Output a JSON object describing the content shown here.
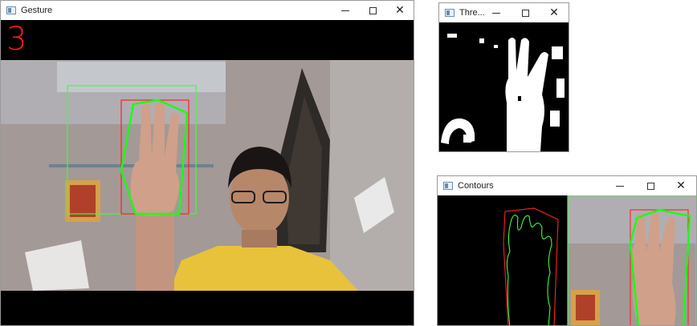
{
  "gesture_window": {
    "title": "Gesture",
    "gesture_count": "3",
    "controls": {
      "minimize": "—",
      "maximize": "☐",
      "close": "✕"
    }
  },
  "threshold_window": {
    "title": "Thre...",
    "controls": {
      "minimize": "—",
      "maximize": "☐",
      "close": "✕"
    }
  },
  "contours_window": {
    "title": "Contours",
    "controls": {
      "minimize": "—",
      "maximize": "☐",
      "close": "✕"
    }
  },
  "colors": {
    "count_text": "#ff1a1a",
    "roi_box": "#3cff3c",
    "hull": "#18ff18",
    "bounding_rect": "#ff2020",
    "shirt": "#e8c23a",
    "wall": "#9a8f8c"
  }
}
